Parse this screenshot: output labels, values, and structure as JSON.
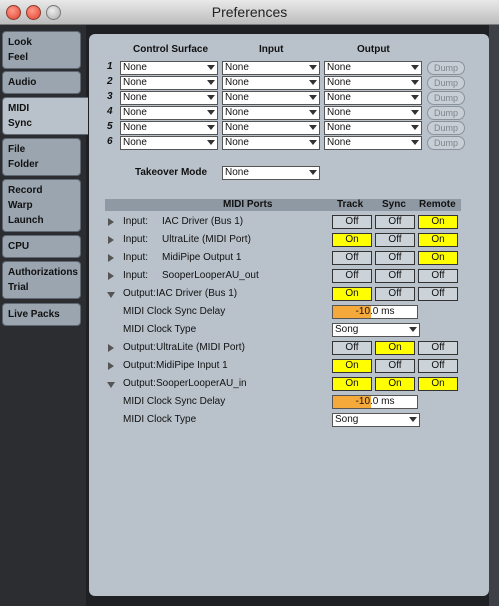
{
  "window": {
    "title": "Preferences"
  },
  "sidebar": {
    "tabs": [
      {
        "lines": [
          "Look",
          "Feel"
        ]
      },
      {
        "lines": [
          "Audio"
        ]
      },
      {
        "lines": [
          "MIDI",
          "Sync"
        ],
        "active": true
      },
      {
        "lines": [
          "File",
          "Folder"
        ]
      },
      {
        "lines": [
          "Record",
          "Warp",
          "Launch"
        ]
      },
      {
        "lines": [
          "CPU"
        ]
      },
      {
        "lines": [
          "Authorizations",
          "Trial"
        ]
      },
      {
        "lines": [
          "Live Packs"
        ]
      }
    ]
  },
  "control_surfaces": {
    "headers": {
      "control_surface": "Control Surface",
      "input": "Input",
      "output": "Output"
    },
    "rows": [
      {
        "num": "1",
        "surface": "None",
        "input": "None",
        "output": "None",
        "dump": "Dump"
      },
      {
        "num": "2",
        "surface": "None",
        "input": "None",
        "output": "None",
        "dump": "Dump"
      },
      {
        "num": "3",
        "surface": "None",
        "input": "None",
        "output": "None",
        "dump": "Dump"
      },
      {
        "num": "4",
        "surface": "None",
        "input": "None",
        "output": "None",
        "dump": "Dump"
      },
      {
        "num": "5",
        "surface": "None",
        "input": "None",
        "output": "None",
        "dump": "Dump"
      },
      {
        "num": "6",
        "surface": "None",
        "input": "None",
        "output": "None",
        "dump": "Dump"
      }
    ]
  },
  "takeover": {
    "label": "Takeover Mode",
    "value": "None"
  },
  "midi_ports": {
    "headers": {
      "ports": "MIDI Ports",
      "track": "Track",
      "sync": "Sync",
      "remote": "Remote"
    },
    "rows": [
      {
        "kind": "port",
        "io": "Input:",
        "name": "IAC Driver (Bus 1)",
        "expanded": false,
        "track": "Off",
        "sync": "Off",
        "remote": "On"
      },
      {
        "kind": "port",
        "io": "Input:",
        "name": "UltraLite (MIDI Port)",
        "expanded": false,
        "track": "On",
        "sync": "Off",
        "remote": "On"
      },
      {
        "kind": "port",
        "io": "Input:",
        "name": "MidiPipe Output 1",
        "expanded": false,
        "track": "Off",
        "sync": "Off",
        "remote": "On"
      },
      {
        "kind": "port",
        "io": "Input:",
        "name": "SooperLooperAU_out",
        "expanded": false,
        "track": "Off",
        "sync": "Off",
        "remote": "Off"
      },
      {
        "kind": "port",
        "io": "Output:",
        "name": "IAC Driver (Bus 1)",
        "expanded": true,
        "track": "On",
        "sync": "Off",
        "remote": "Off"
      },
      {
        "kind": "delay",
        "label": "MIDI Clock Sync Delay",
        "value": "-10.0 ms",
        "fill": 0.45
      },
      {
        "kind": "clock",
        "label": "MIDI Clock Type",
        "value": "Song"
      },
      {
        "kind": "port",
        "io": "Output:",
        "name": "UltraLite (MIDI Port)",
        "expanded": false,
        "track": "Off",
        "sync": "On",
        "remote": "Off"
      },
      {
        "kind": "port",
        "io": "Output:",
        "name": "MidiPipe Input 1",
        "expanded": false,
        "track": "On",
        "sync": "Off",
        "remote": "Off"
      },
      {
        "kind": "port",
        "io": "Output:",
        "name": "SooperLooperAU_in",
        "expanded": true,
        "track": "On",
        "sync": "On",
        "remote": "On"
      },
      {
        "kind": "delay",
        "label": "MIDI Clock Sync Delay",
        "value": "-10.0 ms",
        "fill": 0.45
      },
      {
        "kind": "clock",
        "label": "MIDI Clock Type",
        "value": "Song"
      }
    ]
  },
  "colors": {
    "on": "#ffff00",
    "off": "#cbd2d8",
    "delay_fill": "#f5a93a",
    "panel": "#b9c2cb"
  }
}
